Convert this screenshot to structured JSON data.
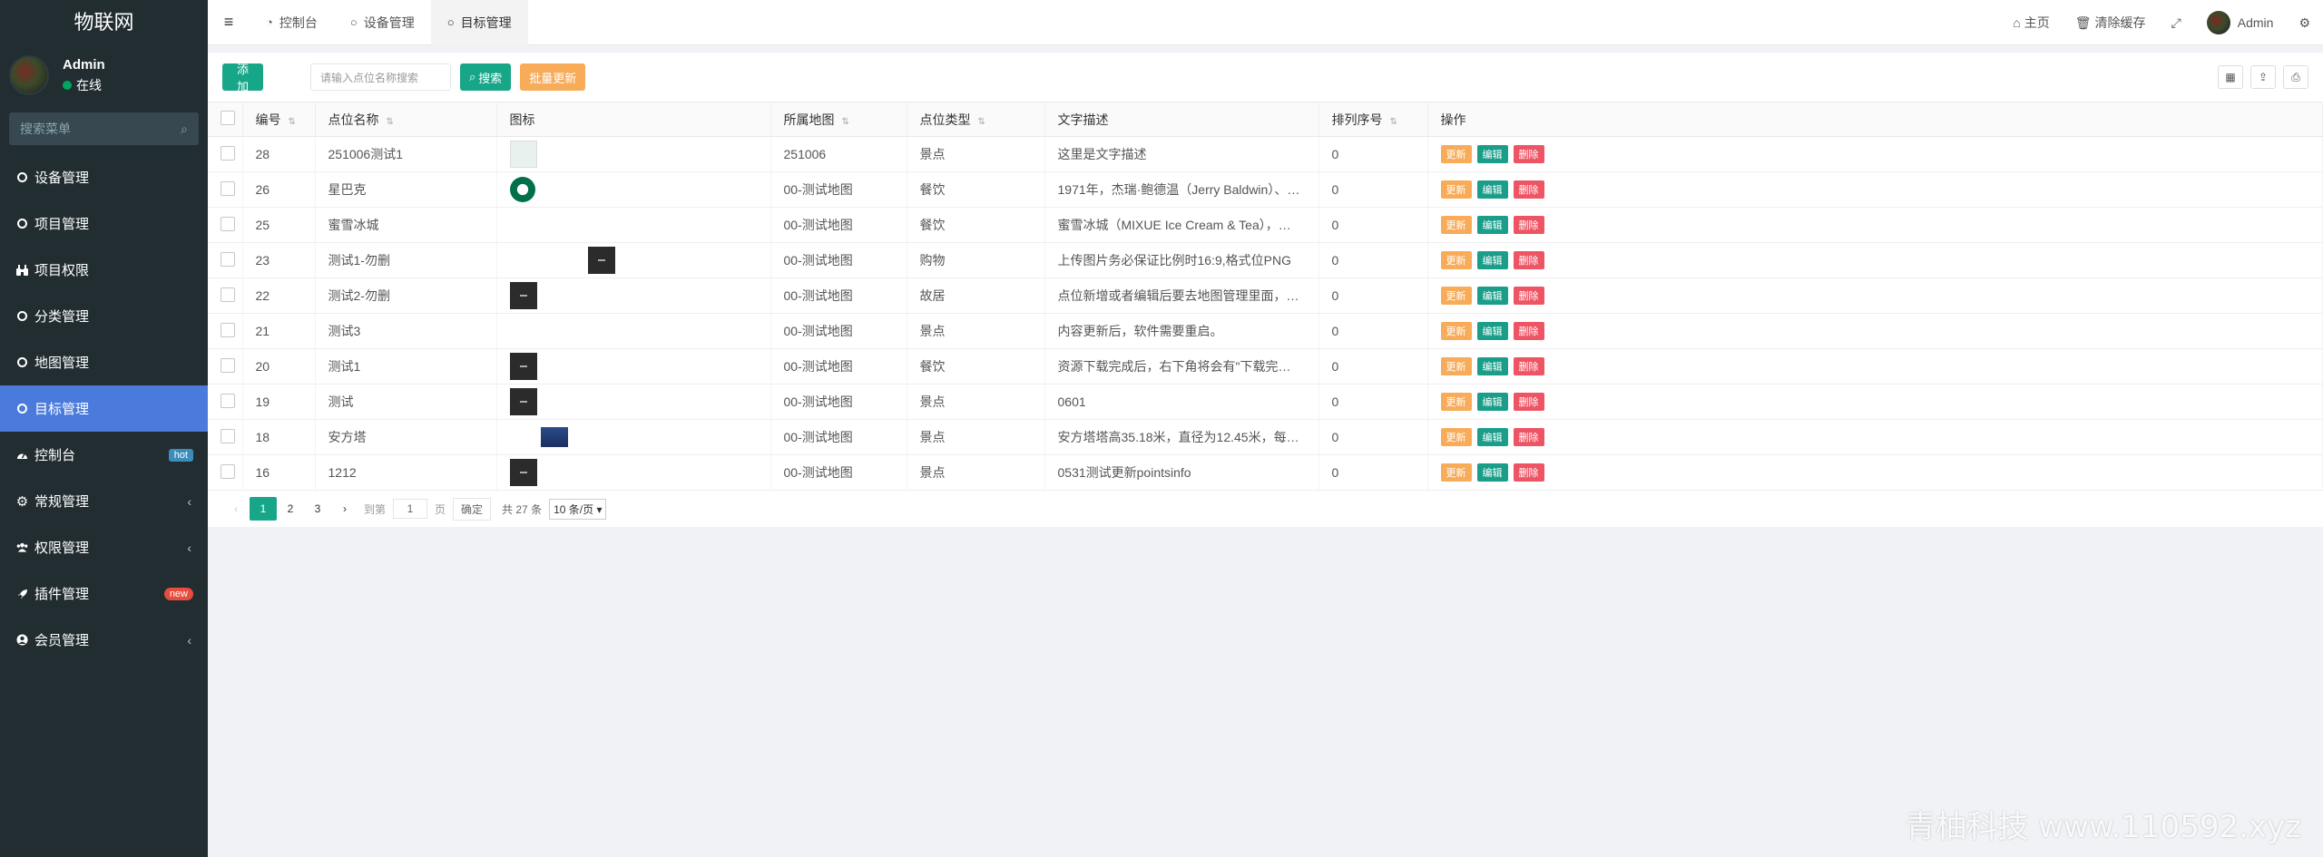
{
  "app": {
    "brand": "物联网"
  },
  "user": {
    "name": "Admin",
    "status": "在线"
  },
  "sidebar": {
    "search_placeholder": "搜索菜单",
    "items": [
      {
        "label": "设备管理",
        "icon": "circle-icon"
      },
      {
        "label": "项目管理",
        "icon": "circle-icon"
      },
      {
        "label": "项目权限",
        "icon": "binoculars-icon"
      },
      {
        "label": "分类管理",
        "icon": "circle-icon"
      },
      {
        "label": "地图管理",
        "icon": "circle-icon"
      },
      {
        "label": "目标管理",
        "icon": "circle-icon",
        "active": true
      },
      {
        "label": "控制台",
        "icon": "dashboard-icon",
        "badge": "hot"
      },
      {
        "label": "常规管理",
        "icon": "cogs-icon",
        "chevron": "‹"
      },
      {
        "label": "权限管理",
        "icon": "group-icon",
        "chevron": "‹"
      },
      {
        "label": "插件管理",
        "icon": "rocket-icon",
        "badge": "new"
      },
      {
        "label": "会员管理",
        "icon": "user-circle-icon",
        "chevron": "‹"
      }
    ]
  },
  "topbar": {
    "tabs": [
      {
        "label": "控制台"
      },
      {
        "label": "设备管理"
      },
      {
        "label": "目标管理"
      }
    ],
    "home": "主页",
    "clear_cache": "清除缓存",
    "admin": "Admin"
  },
  "toolbar": {
    "add": "添加",
    "search_placeholder": "请输入点位名称搜索",
    "search": "搜索",
    "batch_update": "批量更新"
  },
  "table": {
    "columns": [
      "编号",
      "点位名称",
      "图标",
      "所属地图",
      "点位类型",
      "文字描述",
      "排列序号",
      "操作"
    ],
    "actions": {
      "update": "更新",
      "edit": "编辑",
      "delete": "删除"
    },
    "rows": [
      {
        "id": "28",
        "name": "251006测试1",
        "icon": "light",
        "map": "251006",
        "type": "景点",
        "desc": "这里是文字描述",
        "order": "0"
      },
      {
        "id": "26",
        "name": "星巴克",
        "icon": "starbucks",
        "map": "00-测试地图",
        "type": "餐饮",
        "desc": "1971年，杰瑞·鲍德温（Jerry Baldwin）、…",
        "order": "0"
      },
      {
        "id": "25",
        "name": "蜜雪冰城",
        "icon": "none",
        "map": "00-测试地图",
        "type": "餐饮",
        "desc": "蜜雪冰城（MIXUE Ice Cream & Tea），…",
        "order": "0"
      },
      {
        "id": "23",
        "name": "测试1-勿删",
        "icon": "dark-offset",
        "map": "00-测试地图",
        "type": "购物",
        "desc": "上传图片务必保证比例时16:9,格式位PNG",
        "order": "0"
      },
      {
        "id": "22",
        "name": "测试2-勿删",
        "icon": "dark",
        "map": "00-测试地图",
        "type": "故居",
        "desc": "点位新增或者编辑后要去地图管理里面，…",
        "order": "0"
      },
      {
        "id": "21",
        "name": "测试3",
        "icon": "none",
        "map": "00-测试地图",
        "type": "景点",
        "desc": "内容更新后，软件需要重启。",
        "order": "0"
      },
      {
        "id": "20",
        "name": "测试1",
        "icon": "dark",
        "map": "00-测试地图",
        "type": "餐饮",
        "desc": "资源下载完成后，右下角将会有\"下载完…",
        "order": "0"
      },
      {
        "id": "19",
        "name": "测试",
        "icon": "dark",
        "map": "00-测试地图",
        "type": "景点",
        "desc": "0601",
        "order": "0"
      },
      {
        "id": "18",
        "name": "安方塔",
        "icon": "tower",
        "map": "00-测试地图",
        "type": "景点",
        "desc": "安方塔塔高35.18米，直径为12.45米，每…",
        "order": "0"
      },
      {
        "id": "16",
        "name": "1212",
        "icon": "dark",
        "map": "00-测试地图",
        "type": "景点",
        "desc": "0531测试更新pointsinfo",
        "order": "0"
      }
    ]
  },
  "pagination": {
    "pages": [
      "1",
      "2",
      "3"
    ],
    "current": "1",
    "goto_label": "到第",
    "goto_value": "1",
    "page_unit": "页",
    "confirm": "确定",
    "total": "共 27 条",
    "page_size": "10 条/页"
  },
  "watermark": "青柚科技 www.110592.xyz",
  "colors": {
    "sidebar_bg": "#222d32",
    "active": "#4a7bdc",
    "primary": "#18a689",
    "warning": "#f8ac59",
    "danger": "#ed5565"
  }
}
